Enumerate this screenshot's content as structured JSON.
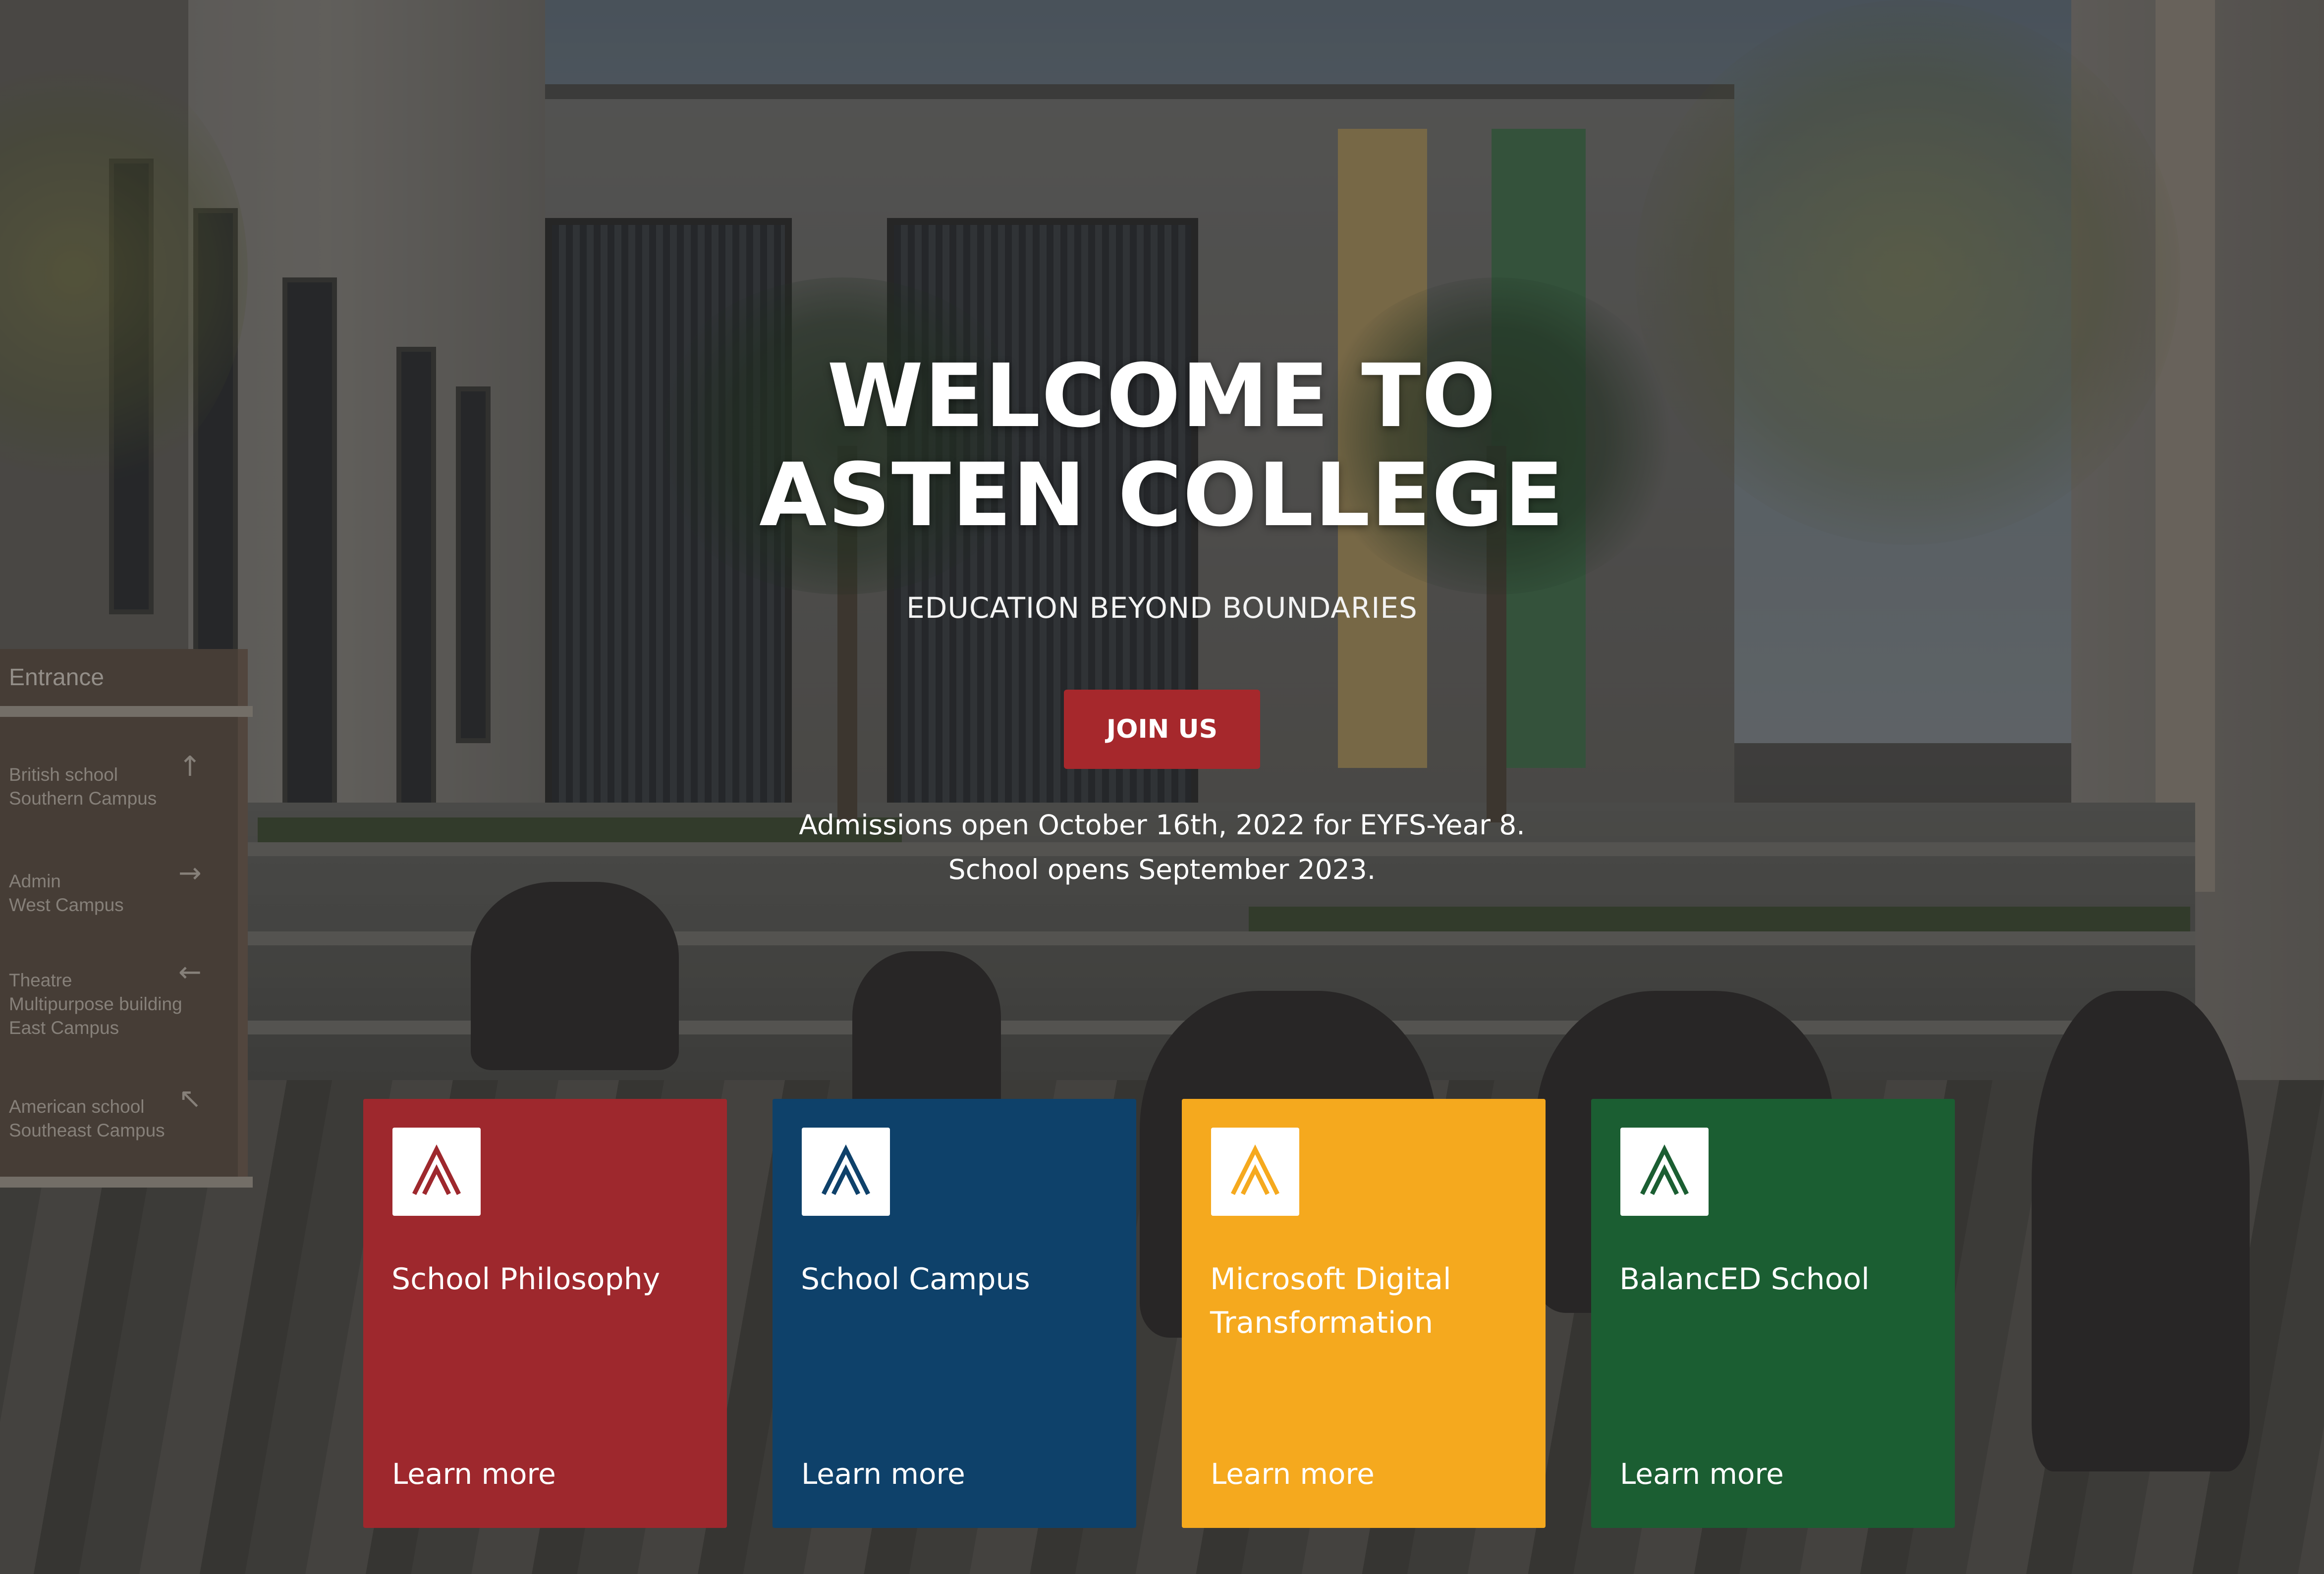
{
  "hero": {
    "title_line1": "WELCOME TO",
    "title_line2": "ASTEN COLLEGE",
    "tagline": "EDUCATION BEYOND BOUNDARIES",
    "join_label": "JOIN US",
    "admissions_line1": "Admissions open October 16th, 2022 for EYFS-Year 8.",
    "admissions_line2": "School opens September 2023.",
    "overlay_color": "#191919"
  },
  "background_sign": {
    "heading": "Entrance",
    "items": [
      {
        "line1": "British school",
        "line2": "Southern Campus",
        "arrow": "↑"
      },
      {
        "line1": "Admin",
        "line2": "West Campus",
        "arrow": "→"
      },
      {
        "line1": "Theatre",
        "line2": "Multipurpose building",
        "line3": "East Campus",
        "arrow": "←"
      },
      {
        "line1": "American school",
        "line2": "Southeast Campus",
        "arrow": "↖"
      }
    ]
  },
  "cards": [
    {
      "title": "School Philosophy",
      "link": "Learn more",
      "color": "#9e282d",
      "logo_color": "#9e282d",
      "icon": "asten-logo-icon"
    },
    {
      "title": "School Campus",
      "link": "Learn more",
      "color": "#0e416a",
      "logo_color": "#0e416a",
      "icon": "asten-logo-icon"
    },
    {
      "title": "Microsoft Digital Transformation",
      "link": "Learn more",
      "color": "#f5a91e",
      "logo_color": "#f5a91e",
      "icon": "asten-logo-icon"
    },
    {
      "title": "BalancED School",
      "link": "Learn more",
      "color": "#1b5e32",
      "logo_color": "#1b5e32",
      "icon": "asten-logo-icon"
    }
  ]
}
